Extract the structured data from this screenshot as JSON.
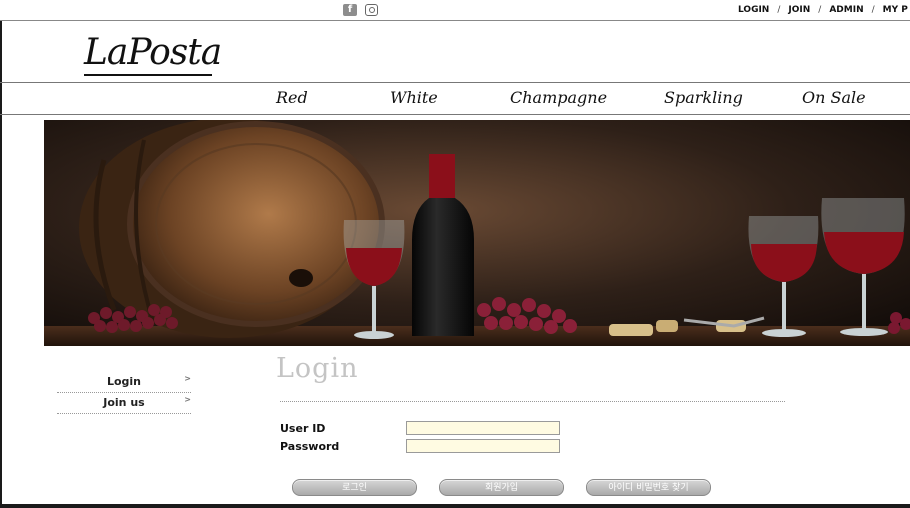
{
  "header": {
    "social_icons": [
      "facebook-icon",
      "instagram-icon"
    ],
    "links": [
      "LOGIN",
      "JOIN",
      "ADMIN",
      "MY P"
    ],
    "separator": "/"
  },
  "brand": {
    "logo_text": "LaPosta"
  },
  "categories": [
    "Red",
    "White",
    "Champagne",
    "Sparkling",
    "On Sale"
  ],
  "sidebar": {
    "items": [
      {
        "label": "Login",
        "arrow": ">"
      },
      {
        "label": "Join us",
        "arrow": ">"
      }
    ]
  },
  "login": {
    "title": "Login",
    "user_id_label": "User ID",
    "password_label": "Password",
    "user_id_value": "",
    "password_value": "",
    "buttons": {
      "login": "로그인",
      "join": "회원가입",
      "find": "아이디 비밀번호 찾기"
    }
  },
  "colors": {
    "wine": "#8b0f1a",
    "hero_background": "#2b1d14",
    "input_background": "#fffbe2",
    "title_gray": "#c4c4c4"
  }
}
